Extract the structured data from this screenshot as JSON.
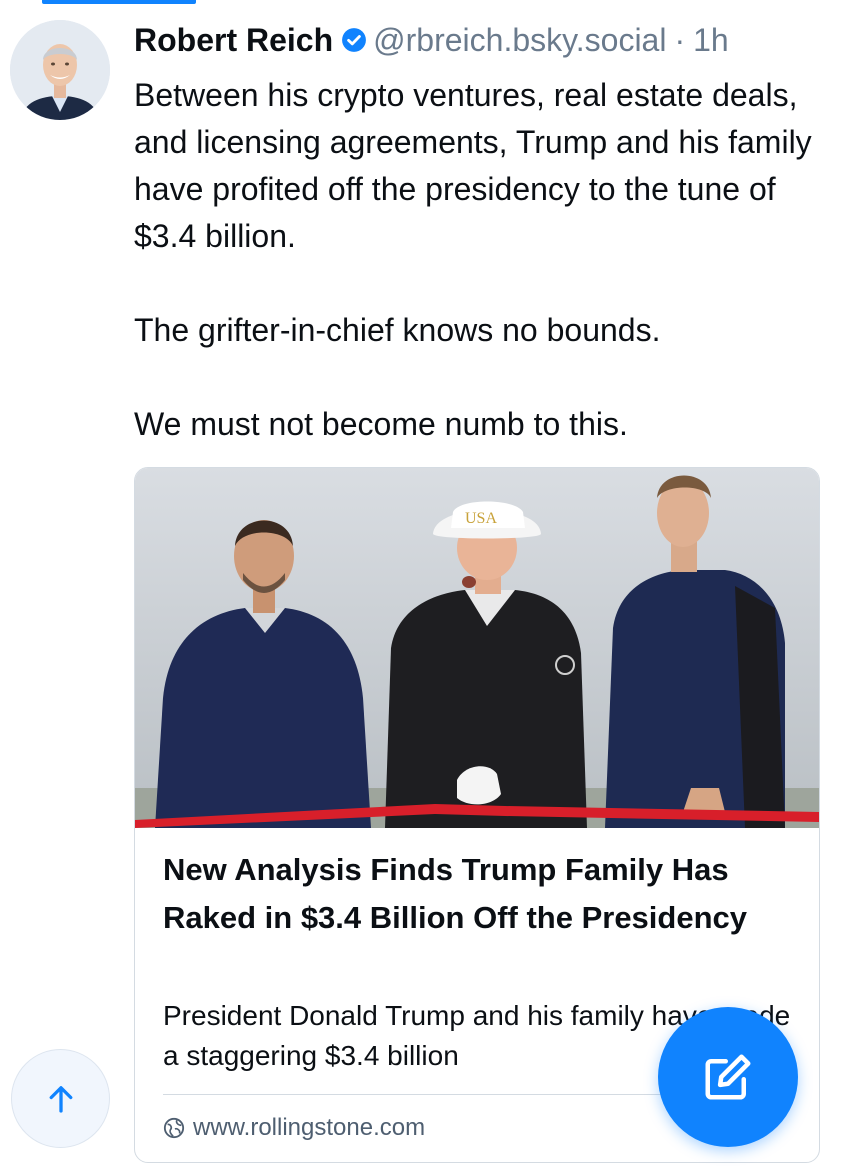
{
  "post": {
    "author_name": "Robert Reich",
    "handle": "@rbreich.bsky.social",
    "separator": "·",
    "timestamp": "1h",
    "paragraphs": [
      "Between his crypto ventures, real estate deals, and licensing agreements, Trump and his family have profited off the presidency to the tune of $3.4 billion.",
      "The grifter-in-chief knows no bounds.",
      "We must not become numb to this."
    ]
  },
  "link_card": {
    "title": "New Analysis Finds Trump Family Has Raked in $3.4 Billion Off the Presidency",
    "description": "President Donald Trump and his family have made a staggering $3.4 billion",
    "domain": "www.rollingstone.com"
  },
  "photo": {
    "cap_text": "USA"
  },
  "icons": {
    "verified": "verified-check-icon",
    "globe": "globe-icon",
    "scroll_top": "arrow-up-icon",
    "compose": "compose-pencil-icon"
  },
  "colors": {
    "accent": "#1083fe",
    "text": "#0b0f14",
    "muted": "#6a7a8c",
    "ribbon": "#d81f2a"
  }
}
